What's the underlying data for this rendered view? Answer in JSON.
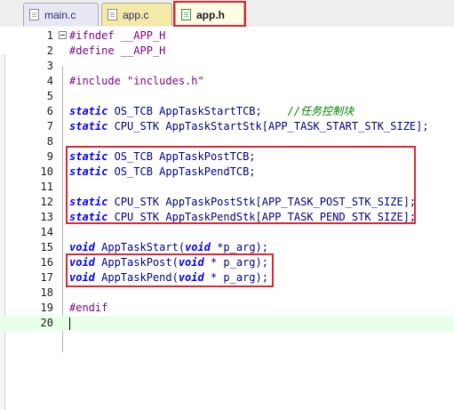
{
  "tabs": [
    {
      "label": "main.c"
    },
    {
      "label": "app.c"
    },
    {
      "label": "app.h"
    }
  ],
  "editor": {
    "line_numbers": [
      "1",
      "2",
      "3",
      "4",
      "5",
      "6",
      "7",
      "8",
      "9",
      "10",
      "11",
      "12",
      "13",
      "14",
      "15",
      "16",
      "17",
      "18",
      "19",
      "20"
    ],
    "lines": [
      [
        {
          "t": "pp",
          "v": "#ifndef __APP_H"
        }
      ],
      [
        {
          "t": "pp",
          "v": "#define __APP_H"
        }
      ],
      [],
      [
        {
          "t": "pp",
          "v": "#include "
        },
        {
          "t": "str",
          "v": "\"includes.h\""
        }
      ],
      [],
      [
        {
          "t": "kw",
          "v": "static"
        },
        {
          "t": "tx",
          "v": " OS_TCB AppTaskStartTCB;    "
        },
        {
          "t": "cmt",
          "v": "//任务控制块"
        }
      ],
      [
        {
          "t": "kw",
          "v": "static"
        },
        {
          "t": "tx",
          "v": " CPU_STK AppTaskStartStk[APP_TASK_START_STK_SIZE];"
        }
      ],
      [],
      [
        {
          "t": "kw",
          "v": "static"
        },
        {
          "t": "tx",
          "v": " OS_TCB AppTaskPostTCB;"
        }
      ],
      [
        {
          "t": "kw",
          "v": "static"
        },
        {
          "t": "tx",
          "v": " OS_TCB AppTaskPendTCB;"
        }
      ],
      [],
      [
        {
          "t": "kw",
          "v": "static"
        },
        {
          "t": "tx",
          "v": " CPU_STK AppTaskPostStk[APP_TASK_POST_STK_SIZE];"
        }
      ],
      [
        {
          "t": "kw",
          "v": "static"
        },
        {
          "t": "tx",
          "v": " CPU_STK AppTaskPendStk[APP_TASK_PEND_STK_SIZE];"
        }
      ],
      [],
      [
        {
          "t": "kw",
          "v": "void"
        },
        {
          "t": "tx",
          "v": " AppTaskStart("
        },
        {
          "t": "kw",
          "v": "void"
        },
        {
          "t": "tx",
          "v": " *p_arg);"
        }
      ],
      [
        {
          "t": "kw",
          "v": "void"
        },
        {
          "t": "tx",
          "v": " AppTaskPost("
        },
        {
          "t": "kw",
          "v": "void"
        },
        {
          "t": "tx",
          "v": " * p_arg);"
        }
      ],
      [
        {
          "t": "kw",
          "v": "void"
        },
        {
          "t": "tx",
          "v": " AppTaskPend("
        },
        {
          "t": "kw",
          "v": "void"
        },
        {
          "t": "tx",
          "v": " * p_arg);"
        }
      ],
      [],
      [
        {
          "t": "pp",
          "v": "#endif"
        }
      ],
      []
    ]
  },
  "colors": {
    "highlight_box": "#e0252f",
    "keyword": "#0000ff",
    "preprocessor": "#7f007f",
    "comment": "#008000",
    "current_line": "#e8ffe8"
  }
}
